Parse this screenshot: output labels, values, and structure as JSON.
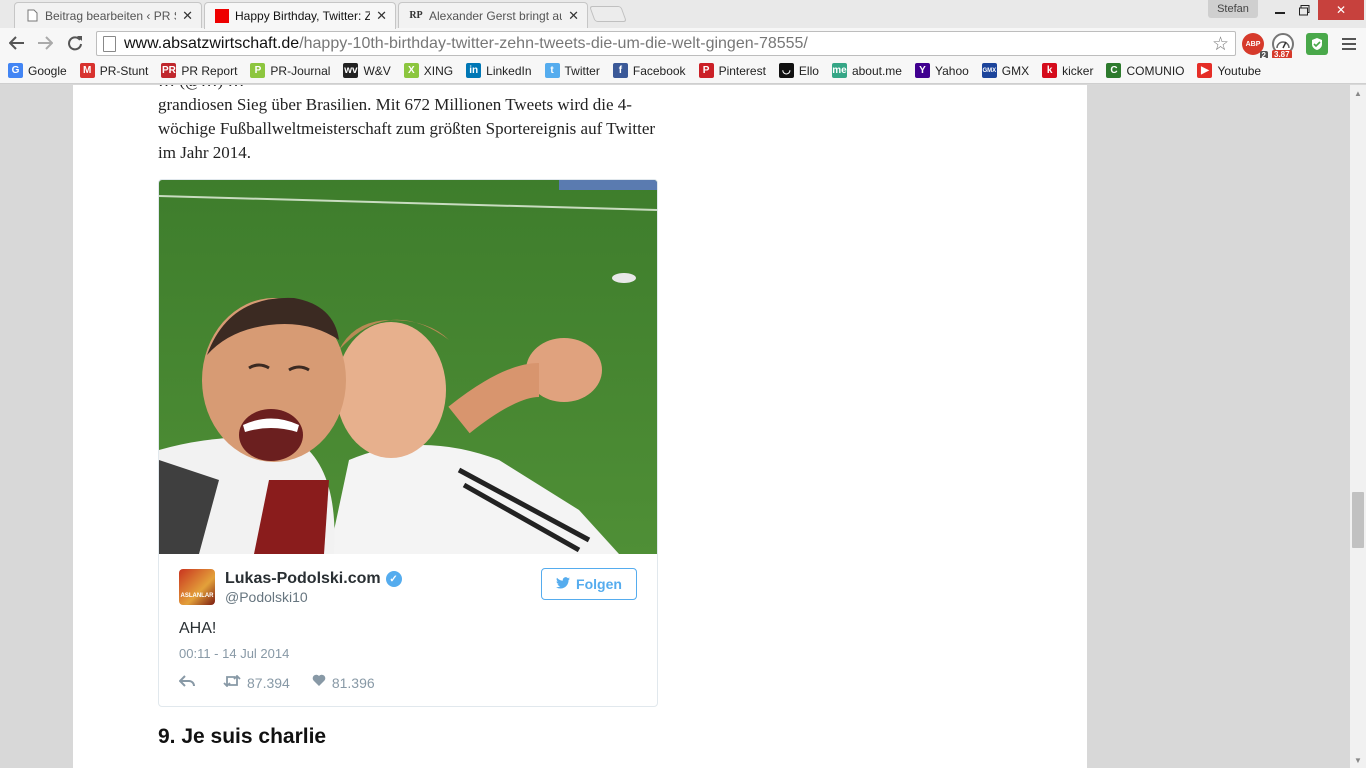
{
  "browser": {
    "tabs": [
      {
        "title": "Beitrag bearbeiten ‹ PR St",
        "favicon": "document-icon",
        "active": false
      },
      {
        "title": "Happy Birthday, Twitter: Z",
        "favicon": "red-square-icon",
        "active": true
      },
      {
        "title": "Alexander Gerst bringt au",
        "favicon": "rp-icon",
        "active": false
      }
    ],
    "favicon_rp": "RP",
    "profile_name": "Stefan",
    "url_host": "www.absatzwirtschaft.de",
    "url_path": "/happy-10th-birthday-twitter-zehn-tweets-die-um-die-welt-gingen-78555/",
    "extensions": {
      "abp_label": "ABP",
      "abp_count": "2",
      "gauge_value": "3.87"
    },
    "bookmarks": [
      {
        "label": "Google",
        "icon": "google-icon",
        "color": "#4285f4",
        "glyph": "G"
      },
      {
        "label": "PR-Stunt",
        "icon": "pr-stunt-icon",
        "color": "#d8322e",
        "glyph": "M"
      },
      {
        "label": "PR Report",
        "icon": "pr-report-icon",
        "color": "#c0272d",
        "glyph": "PR"
      },
      {
        "label": "PR-Journal",
        "icon": "pr-journal-icon",
        "color": "#8dc63f",
        "glyph": "P"
      },
      {
        "label": "W&V",
        "icon": "wv-icon",
        "color": "#222222",
        "glyph": "wv"
      },
      {
        "label": "XING",
        "icon": "xing-icon",
        "color": "#8cc63f",
        "glyph": "X"
      },
      {
        "label": "LinkedIn",
        "icon": "linkedin-icon",
        "color": "#0077b5",
        "glyph": "in"
      },
      {
        "label": "Twitter",
        "icon": "twitter-icon",
        "color": "#55acee",
        "glyph": "t"
      },
      {
        "label": "Facebook",
        "icon": "facebook-icon",
        "color": "#3b5998",
        "glyph": "f"
      },
      {
        "label": "Pinterest",
        "icon": "pinterest-icon",
        "color": "#cb2027",
        "glyph": "P"
      },
      {
        "label": "Ello",
        "icon": "ello-icon",
        "color": "#111111",
        "glyph": "◡"
      },
      {
        "label": "about.me",
        "icon": "aboutme-icon",
        "color": "#35a686",
        "glyph": "me"
      },
      {
        "label": "Yahoo",
        "icon": "yahoo-icon",
        "color": "#400090",
        "glyph": "Y"
      },
      {
        "label": "GMX",
        "icon": "gmx-icon",
        "color": "#1c449b",
        "glyph": "GMX"
      },
      {
        "label": "kicker",
        "icon": "kicker-icon",
        "color": "#d50c1c",
        "glyph": "k"
      },
      {
        "label": "COMUNIO",
        "icon": "comunio-icon",
        "color": "#2d7a2d",
        "glyph": "C"
      },
      {
        "label": "Youtube",
        "icon": "youtube-icon",
        "color": "#e52d27",
        "glyph": "▶"
      }
    ]
  },
  "article": {
    "paragraph_partial_top": "… (@…) …",
    "paragraph_line1": "grandiosen Sieg über Brasilien. Mit 672 Millionen Tweets wird die 4-",
    "paragraph_line2": "wöchige Fußballweltmeisterschaft zum größten Sportereignis auf Twitter",
    "paragraph_line3": "im Jahr 2014.",
    "section_heading": "9. Je suis charlie"
  },
  "tweet": {
    "author_name": "Lukas-Podolski.com",
    "author_handle": "@Podolski10",
    "avatar_text": "ASLANLAR",
    "follow_label": "Folgen",
    "text": "AHA!",
    "timestamp": "00:11 - 14 Jul 2014",
    "retweets": "87.394",
    "likes": "81.396"
  },
  "colors": {
    "twitter_blue": "#55acee",
    "close_red": "#c7413d"
  }
}
